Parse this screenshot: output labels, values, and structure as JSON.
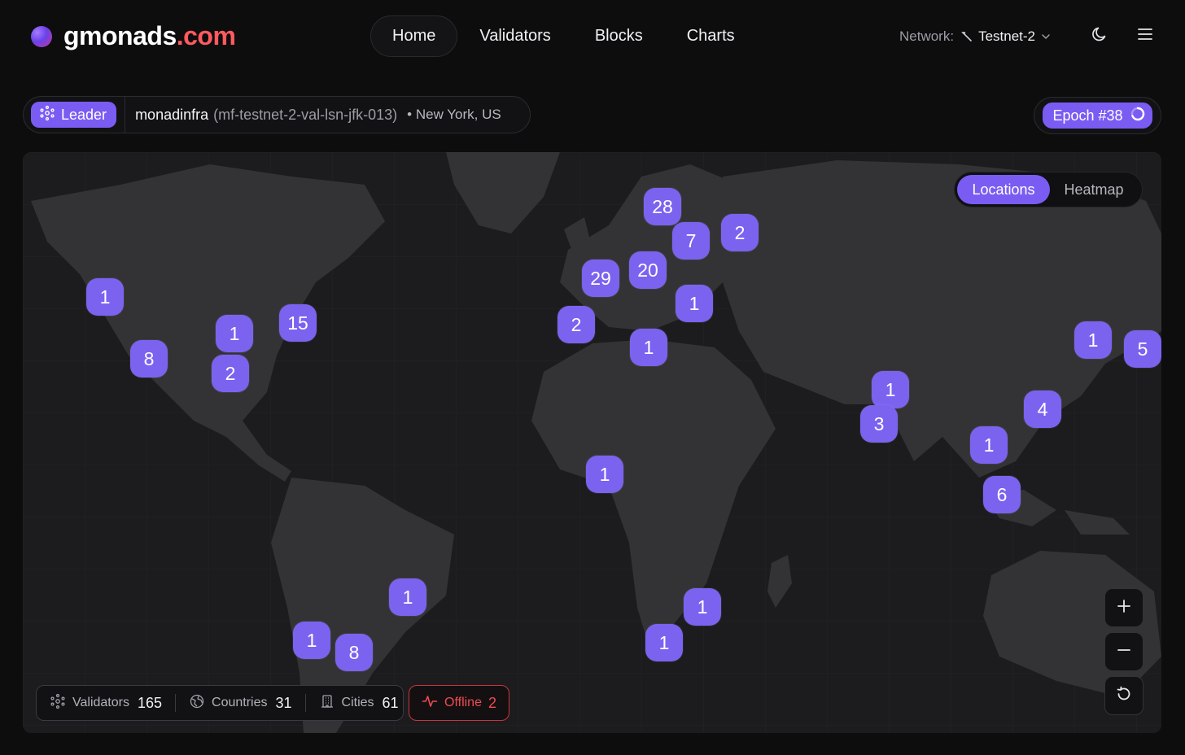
{
  "brand": {
    "name": "gmonads",
    "tld": ".com"
  },
  "nav": {
    "items": [
      "Home",
      "Validators",
      "Blocks",
      "Charts"
    ],
    "active": "Home"
  },
  "network": {
    "label": "Network:",
    "value": "Testnet-2"
  },
  "leader": {
    "badge": "Leader",
    "name": "monadinfra",
    "host": "(mf-testnet-2-val-lsn-jfk-013)",
    "location": "• New York, US"
  },
  "epoch": {
    "label": "Epoch #38"
  },
  "map_toggle": {
    "options": [
      "Locations",
      "Heatmap"
    ],
    "active": "Locations"
  },
  "markers": [
    "1",
    "8",
    "1",
    "2",
    "15",
    "28",
    "7",
    "2",
    "29",
    "20",
    "1",
    "2",
    "1",
    "1",
    "3",
    "1",
    "5",
    "4",
    "1",
    "6",
    "1",
    "1",
    "1",
    "8",
    "1",
    "1"
  ],
  "stats": {
    "validators": {
      "label": "Validators",
      "value": "165"
    },
    "countries": {
      "label": "Countries",
      "value": "31"
    },
    "cities": {
      "label": "Cities",
      "value": "61"
    },
    "offline": {
      "label": "Offline",
      "value": "2"
    }
  },
  "colors": {
    "accent": "#7a5cf3",
    "marker": "#7b63f0",
    "offline": "#ee4b52",
    "brand_tld": "#ff5a5f"
  },
  "icons": [
    "validator-nodes-icon",
    "globe-icon",
    "building-icon",
    "activity-pulse-icon",
    "moon-icon",
    "menu-icon",
    "chevron-down-icon",
    "plus-icon",
    "minus-icon",
    "reset-icon",
    "loading-ring-icon",
    "hammer-icon"
  ]
}
